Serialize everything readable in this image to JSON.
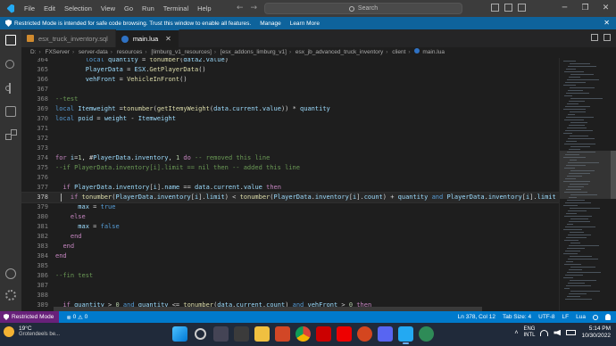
{
  "menu": [
    "File",
    "Edit",
    "Selection",
    "View",
    "Go",
    "Run",
    "Terminal",
    "Help"
  ],
  "search_placeholder": "Search",
  "banner": {
    "text": "Restricted Mode is intended for safe code browsing. Trust this window to enable all features.",
    "manage": "Manage",
    "learn_more": "Learn More"
  },
  "tabs": [
    {
      "label": "esx_truck_inventory.sql",
      "icon": "sql-file-icon"
    },
    {
      "label": "main.lua",
      "icon": "lua-file-icon"
    }
  ],
  "breadcrumb": [
    "D:",
    "FXServer",
    "server-data",
    "resources",
    "[limburg_v1_resources]",
    "[esx_addons_limburg_v1]",
    "esx_jb_advanced_truck_inventory",
    "client",
    "main.lua"
  ],
  "code": [
    {
      "n": "364",
      "t": "        local quantity = tonumber(data2.value)"
    },
    {
      "n": "365",
      "t": "        PlayerData = ESX.GetPlayerData()"
    },
    {
      "n": "366",
      "t": "        vehFront = VehicleInFront()"
    },
    {
      "n": "367",
      "t": ""
    },
    {
      "n": "368",
      "t": "--test"
    },
    {
      "n": "369",
      "t": "local Itemweight =tonumber(getItemyWeight(data.current.value)) * quantity"
    },
    {
      "n": "370",
      "t": "local poid = weight - Itemweight"
    },
    {
      "n": "371",
      "t": ""
    },
    {
      "n": "372",
      "t": ""
    },
    {
      "n": "373",
      "t": ""
    },
    {
      "n": "374",
      "t": "for i=1, #PlayerData.inventory, 1 do -- removed this line"
    },
    {
      "n": "375",
      "t": "--if PlayerData.inventory[i].limit == nil then -- added this line"
    },
    {
      "n": "376",
      "t": ""
    },
    {
      "n": "377",
      "t": "  if PlayerData.inventory[i].name == data.current.value then"
    },
    {
      "n": "378",
      "t": "    if tonumber(PlayerData.inventory[i].limit) < tonumber(PlayerData.inventory[i].count) + quantity and PlayerData.inventory[i].limit ~= -1"
    },
    {
      "n": "379",
      "t": "      max = true"
    },
    {
      "n": "380",
      "t": "    else"
    },
    {
      "n": "381",
      "t": "      max = false"
    },
    {
      "n": "382",
      "t": "    end"
    },
    {
      "n": "383",
      "t": "  end"
    },
    {
      "n": "384",
      "t": "end"
    },
    {
      "n": "385",
      "t": ""
    },
    {
      "n": "386",
      "t": "--fin test"
    },
    {
      "n": "387",
      "t": ""
    },
    {
      "n": "388",
      "t": ""
    },
    {
      "n": "389",
      "t": "  if quantity > 0 and quantity <= tonumber(data.current.count) and vehFront > 0 then"
    },
    {
      "n": "390",
      "t": "  if not max then"
    },
    {
      "n": "391",
      "t": "      TriggerServerEvent('esx_truck_inventory:removeInventoryItem', GetVehicleNumberPlateText(vehFront), data.current.value, data.current.ty"
    }
  ],
  "current_line": "378",
  "status": {
    "restricted": "Restricted Mode",
    "errors": "0",
    "warnings": "0",
    "position": "Ln 378, Col 12",
    "tab_size": "Tab Size: 4",
    "encoding": "UTF-8",
    "eol": "LF",
    "language": "Lua"
  },
  "taskbar": {
    "temp": "19°C",
    "weather": "Grotendeels be...",
    "lang_top": "ENG",
    "lang_bottom": "INTL",
    "time": "5:14 PM",
    "date": "10/30/2022"
  },
  "colors": {
    "keyword": "#569cd6",
    "control": "#c586c0",
    "function": "#dcdcaa",
    "variable": "#9cdcfe",
    "string": "#ce9178",
    "number": "#b5cea8",
    "comment": "#6a9955",
    "accent": "#007acc",
    "restricted": "#68217a"
  }
}
